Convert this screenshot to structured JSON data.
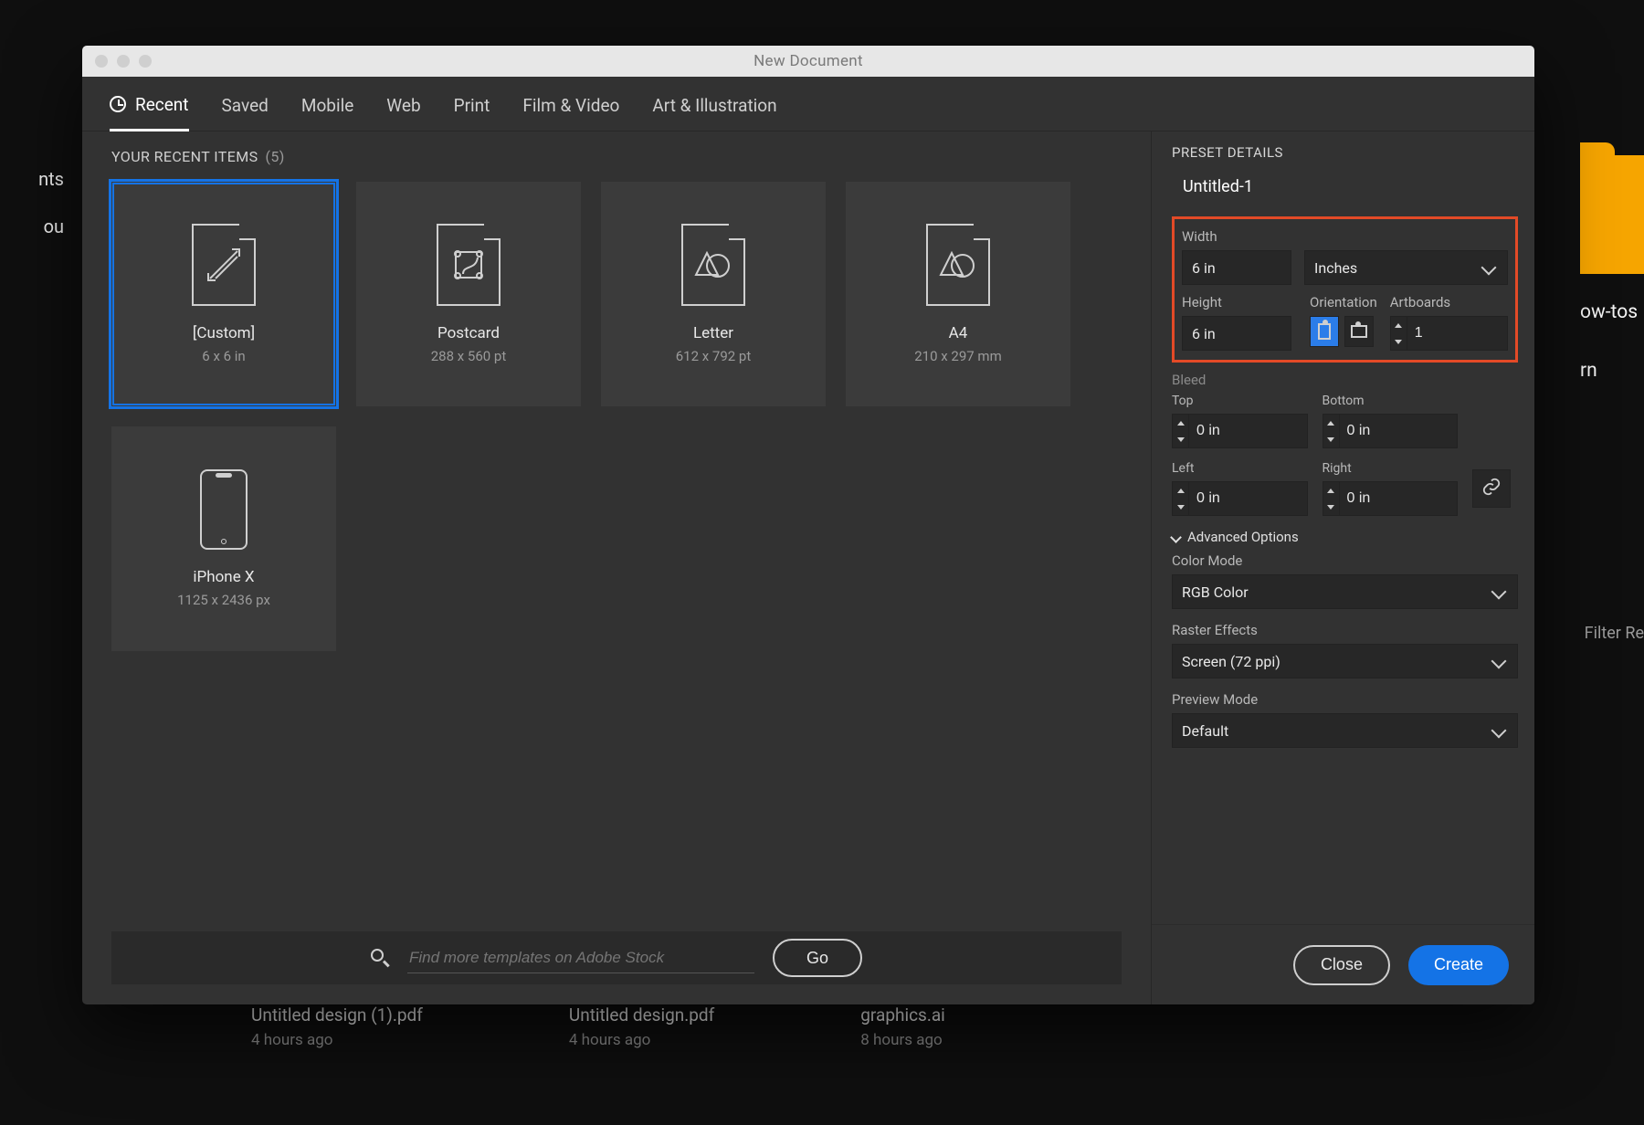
{
  "dialog_title": "New Document",
  "tabs": [
    "Recent",
    "Saved",
    "Mobile",
    "Web",
    "Print",
    "Film & Video",
    "Art & Illustration"
  ],
  "recent_header": "YOUR RECENT ITEMS",
  "recent_count": "(5)",
  "cards": [
    {
      "name": "[Custom]",
      "sub": "6 x 6 in",
      "selected": true,
      "kind": "custom"
    },
    {
      "name": "Postcard",
      "sub": "288 x 560 pt",
      "selected": false,
      "kind": "postcard"
    },
    {
      "name": "Letter",
      "sub": "612 x 792 pt",
      "selected": false,
      "kind": "shape"
    },
    {
      "name": "A4",
      "sub": "210 x 297 mm",
      "selected": false,
      "kind": "shape"
    },
    {
      "name": "iPhone X",
      "sub": "1125 x 2436 px",
      "selected": false,
      "kind": "phone"
    }
  ],
  "stock_placeholder": "Find more templates on Adobe Stock",
  "go_label": "Go",
  "preset": {
    "section_title": "PRESET DETAILS",
    "doc_name": "Untitled-1",
    "width_label": "Width",
    "width_value": "6 in",
    "units_label": "Inches",
    "height_label": "Height",
    "height_value": "6 in",
    "orientation_label": "Orientation",
    "artboards_label": "Artboards",
    "artboards_value": "1",
    "bleed_label": "Bleed",
    "top_label": "Top",
    "top_value": "0 in",
    "bottom_label": "Bottom",
    "bottom_value": "0 in",
    "left_label": "Left",
    "left_value": "0 in",
    "right_label": "Right",
    "right_value": "0 in",
    "advanced_label": "Advanced Options",
    "color_mode_label": "Color Mode",
    "color_mode_value": "RGB Color",
    "raster_label": "Raster Effects",
    "raster_value": "Screen (72 ppi)",
    "preview_label": "Preview Mode",
    "preview_value": "Default"
  },
  "close_label": "Close",
  "create_label": "Create",
  "backdrop": {
    "left": [
      "nts",
      "ou"
    ],
    "right": [
      "ow-tos",
      "rn"
    ],
    "filter": "Filter Re",
    "recents": [
      {
        "name": "Untitled design (1).pdf",
        "time": "4 hours ago"
      },
      {
        "name": "Untitled design.pdf",
        "time": "4 hours ago"
      },
      {
        "name": "graphics.ai",
        "time": "8 hours ago"
      }
    ]
  }
}
